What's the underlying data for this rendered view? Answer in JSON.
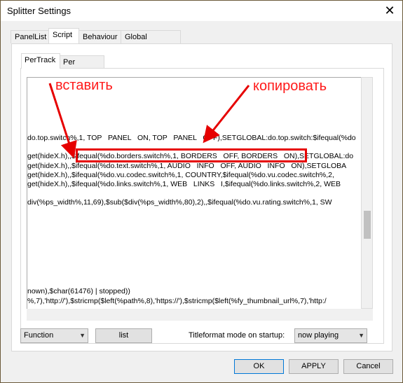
{
  "window": {
    "title": "Splitter Settings",
    "close_glyph": "✕"
  },
  "tabs": [
    "PanelList",
    "Script",
    "Behaviour",
    "Global variables"
  ],
  "subtabs": [
    "PerTrack",
    "Per Second"
  ],
  "annotations": {
    "left": "вставить",
    "right": "копировать",
    "color": "#ff1a1a"
  },
  "code_lines": [
    "do.top.switch%,1, TOP   PANEL   ON, TOP   PANEL   OFF),SETGLOBAL:do.top.switch:$ifequal(%do",
    "get(hideX.h),,$ifequal(%do.borders.switch%,1, BORDERS   OFF, BORDERS   ON),SETGLOBAL:do",
    "get(hideX.h),,$ifequal(%do.text.switch%,1, AUDIO   INFO   OFF, AUDIO   INFO   ON),SETGLOBA",
    "get(hideX.h),,$ifequal(%do.vu.codec.switch%,1, COUNTRY,$ifequal(%do.vu.codec.switch%,2,",
    "get(hideX.h),,$ifequal(%do.links.switch%,1, WEB   LINKS   I,$ifequal(%do.links.switch%,2, WEB",
    "div(%ps_width%,11,69),$sub($div(%ps_width%,80),2),,$ifequal(%do.vu.rating.switch%,1, SW",
    "nown),$char(61476) | stopped))",
    "%,7),'http://'),$stricmp($left(%path%,8),'https://'),$stricmp($left(%fy_thumbnail_url%,7),'http:/"
  ],
  "bottom": {
    "function_select": "Function",
    "list_button": "list",
    "mode_label": "Titleformat mode on startup:",
    "mode_select": "now playing"
  },
  "buttons": {
    "ok": "OK",
    "apply": "APPLY",
    "cancel": "Cancel"
  }
}
